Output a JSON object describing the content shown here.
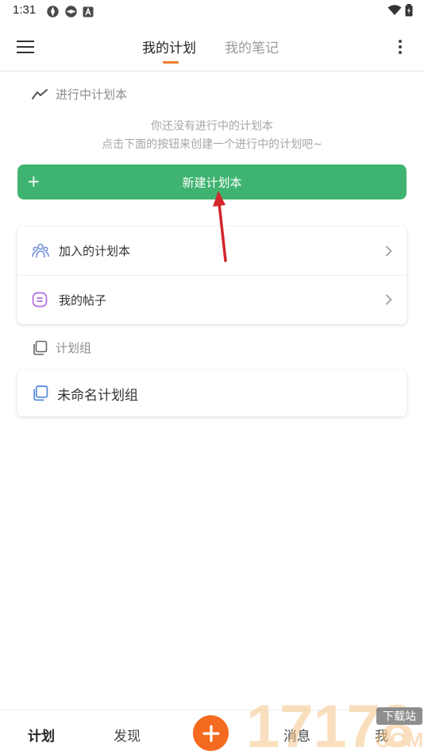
{
  "status_bar": {
    "time": "1:31"
  },
  "app_bar": {
    "tabs": [
      {
        "label": "我的计划"
      },
      {
        "label": "我的笔记"
      }
    ]
  },
  "in_progress": {
    "heading": "进行中计划本",
    "empty_line1": "你还没有进行中的计划本",
    "empty_line2": "点击下面的按钮来创建一个进行中的计划吧~",
    "new_button_label": "新建计划本",
    "new_button_plus": "+"
  },
  "links": [
    {
      "label": "加入的计划本"
    },
    {
      "label": "我的帖子"
    }
  ],
  "groups": {
    "heading": "计划组",
    "items": [
      {
        "label": "未命名计划组"
      }
    ]
  },
  "bottom_nav": {
    "plan": "计划",
    "discover": "发现",
    "messages": "消息",
    "me": "我"
  },
  "watermark": {
    "text": "17178",
    "badge": "下载站",
    "domain": "COM"
  },
  "colors": {
    "accent_green": "#3eb470",
    "tab_indicator": "#f07b2c",
    "add_button": "#f46a1f",
    "arrow_red": "#d2262b"
  }
}
